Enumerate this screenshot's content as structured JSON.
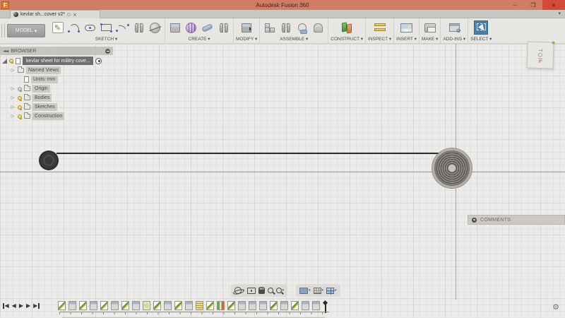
{
  "window": {
    "logo_letter": "F",
    "title": "Autodesk Fusion 360",
    "controls": {
      "minimize": "–",
      "maximize": "❐",
      "close": "×"
    }
  },
  "tabbar": {
    "tab": {
      "label": "kevlar sh...cover v2*",
      "close_glyph": "×"
    },
    "overflow_glyph": "▾"
  },
  "toolbar": {
    "workspace_label": "MODEL",
    "caret": "▾",
    "groups": [
      {
        "label": "SKETCH",
        "icons": [
          "create-sketch",
          "arc",
          "slot",
          "rectangle",
          "spline",
          "mirror",
          "circle"
        ]
      },
      {
        "label": "CREATE",
        "icons": [
          "box",
          "form",
          "cylinder",
          "pattern-mirror"
        ]
      },
      {
        "label": "MODIFY",
        "icons": [
          "press-pull"
        ]
      },
      {
        "label": "ASSEMBLE",
        "icons": [
          "new-component",
          "joint",
          "joint-origin",
          "rigid-group"
        ]
      },
      {
        "label": "CONSTRUCT",
        "icons": [
          "construction-planes"
        ]
      },
      {
        "label": "INSPECT",
        "icons": [
          "measure"
        ]
      },
      {
        "label": "INSERT",
        "icons": [
          "insert-image"
        ]
      },
      {
        "label": "MAKE",
        "icons": [
          "3d-print"
        ]
      },
      {
        "label": "ADD-INS",
        "icons": [
          "scripts-addins"
        ]
      },
      {
        "label": "SELECT",
        "icons": [
          "select-tool"
        ]
      }
    ]
  },
  "browser": {
    "collapse_glyph": "◄◄",
    "title": "BROWSER",
    "expand_glyph": "▷",
    "root": {
      "label": "kevlar sheet for militry cove..."
    },
    "items": [
      {
        "label": "Named Views",
        "bulb": "none",
        "icon": "folder"
      },
      {
        "label": "Units: mm",
        "bulb": "none",
        "icon": "document"
      },
      {
        "label": "Origin",
        "bulb": "off",
        "icon": "folder"
      },
      {
        "label": "Bodies",
        "bulb": "on",
        "icon": "folder"
      },
      {
        "label": "Sketches",
        "bulb": "on",
        "icon": "folder"
      },
      {
        "label": "Construction",
        "bulb": "on",
        "icon": "folder"
      }
    ]
  },
  "viewcube": {
    "face_label": "TOP",
    "x_axis_label": "x"
  },
  "comments": {
    "label": "COMMENTS"
  },
  "navbar": {
    "left_icons": [
      "orbit",
      "look-at",
      "pan",
      "zoom",
      "fit"
    ],
    "right_icons": [
      "display-settings",
      "grid-and-snaps",
      "viewports"
    ]
  },
  "timeline": {
    "playback": {
      "start": "◀",
      "back": "◀",
      "play": "▶",
      "forward": "▶",
      "end": "▶"
    },
    "features": [
      "sketch",
      "extrude",
      "sketch",
      "extrude",
      "sketch",
      "extrude",
      "sketch",
      "extrude",
      "fillet",
      "sketch",
      "extrude",
      "sketch",
      "extrude",
      "press",
      "sketch",
      "appearance",
      "sketch",
      "extrude",
      "extrude",
      "extrude",
      "sketch",
      "extrude",
      "sketch",
      "extrude",
      "extrude"
    ]
  },
  "footer": {
    "settings_glyph": "⚙"
  },
  "colors": {
    "titlebar": "#cf7d64",
    "close_button": "#d14a3a",
    "canvas": "#ecebe9",
    "horizontal_axis": "#989ed4",
    "vertical_axis": "#d09090",
    "selected_item": "#6f6f6f"
  }
}
